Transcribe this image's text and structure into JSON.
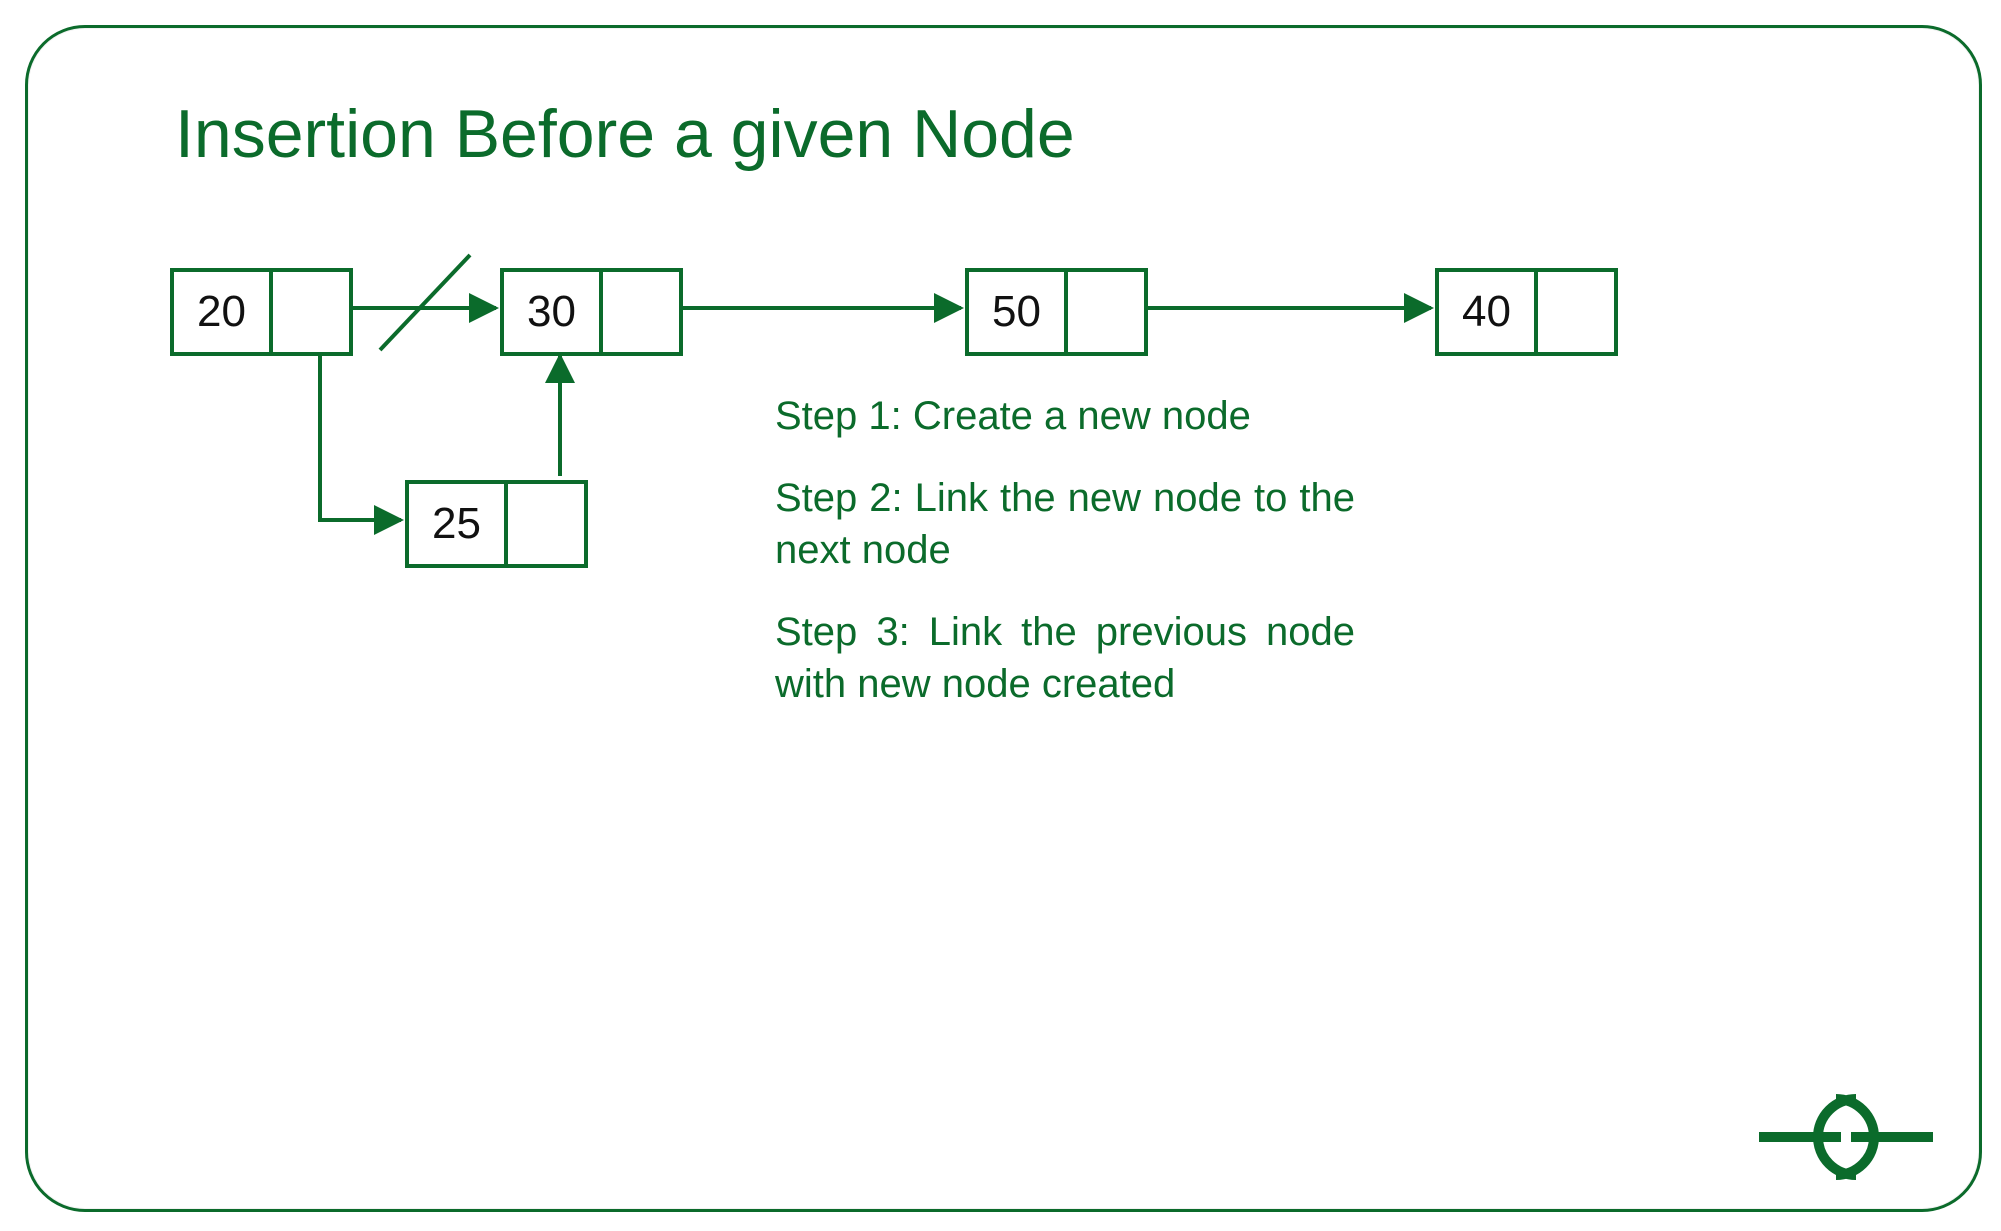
{
  "title": "Insertion Before a given Node",
  "nodes": {
    "n1": "20",
    "n2": "30",
    "n3": "50",
    "n4": "40",
    "new": "25"
  },
  "steps": {
    "s1": "Step 1: Create a new node",
    "s2": "Step 2: Link the new node to the next node",
    "s3": "Step 3: Link the previous node with new node created"
  },
  "colors": {
    "green": "#0b6b2b"
  },
  "logo_name": "geeksforgeeks-logo"
}
